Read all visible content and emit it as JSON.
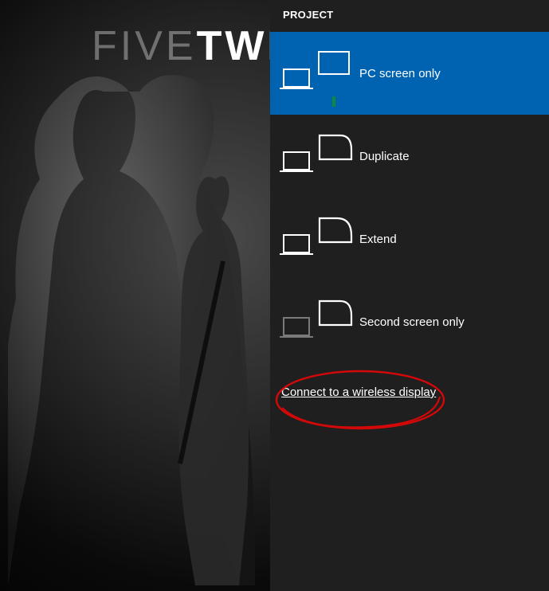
{
  "wallpaper": {
    "text_thin": "FIVE",
    "text_bold": "TWI"
  },
  "panel": {
    "title": "PROJECT",
    "options": [
      {
        "id": "pc-only",
        "label": "PC screen only",
        "selected": true
      },
      {
        "id": "duplicate",
        "label": "Duplicate",
        "selected": false
      },
      {
        "id": "extend",
        "label": "Extend",
        "selected": false
      },
      {
        "id": "second-only",
        "label": "Second screen only",
        "selected": false
      }
    ],
    "wireless_link": "Connect to a wireless display"
  },
  "colors": {
    "accent": "#0063b1",
    "indicator": "#10893e",
    "annotation": "#d30808"
  }
}
